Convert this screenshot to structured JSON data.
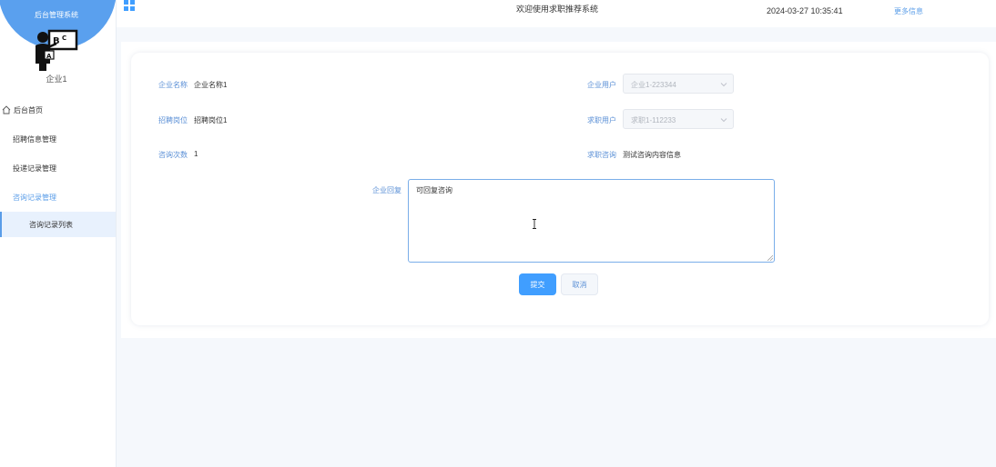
{
  "sidebar": {
    "title": "后台管理系统",
    "user_name": "企业1",
    "menu": {
      "home": "后台首页",
      "recruit_info": "招聘信息管理",
      "delivery_records": "投递记录管理",
      "consult_records": "咨询记录管理",
      "consult_list": "咨询记录列表"
    }
  },
  "header": {
    "welcome": "欢迎使用求职推荐系统",
    "datetime": "2024-03-27 10:35:41",
    "more_info": "更多信息"
  },
  "form": {
    "company_name_label": "企业名称",
    "company_name_value": "企业名称1",
    "company_user_label": "企业用户",
    "company_user_value": "企业1-223344",
    "position_label": "招聘岗位",
    "position_value": "招聘岗位1",
    "job_user_label": "求职用户",
    "job_user_value": "求职1-112233",
    "consult_count_label": "咨询次数",
    "consult_count_value": "1",
    "consult_label": "求职咨询",
    "consult_value": "测试咨询内容信息",
    "reply_label": "企业回复",
    "reply_value": "可回复咨询",
    "submit": "提交",
    "cancel": "取消"
  },
  "colors": {
    "accent": "#409eff",
    "sidebar_blob": "#5aa0ee",
    "label": "#5a8fd6"
  },
  "icons": {
    "grid": "grid-icon",
    "home": "home-icon",
    "chevron": "chevron-down-icon",
    "avatar": "teacher-avatar-icon"
  }
}
